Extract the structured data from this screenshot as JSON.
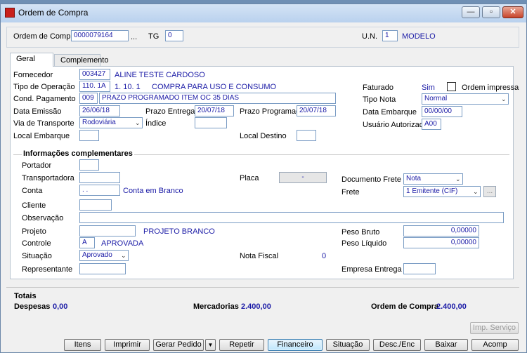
{
  "window": {
    "title": "Ordem de Compra",
    "min_label": "—",
    "max_label": "▫",
    "close_label": "✕"
  },
  "header": {
    "ordem_label": "Ordem de Compra",
    "ordem_value": "0000079164",
    "lookup": "...",
    "tg_label": "TG",
    "tg_value": "0",
    "un_label": "U.N.",
    "un_value": "1",
    "un_desc": "MODELO"
  },
  "tabs": [
    {
      "label": "Geral"
    },
    {
      "label": "Complemento"
    }
  ],
  "geral": {
    "fornecedor_label": "Fornecedor",
    "fornecedor_code": "003427",
    "fornecedor_name": "ALINE TESTE CARDOSO",
    "tipo_op_label": "Tipo de Operação",
    "tipo_op_code": "110. 1A",
    "tipo_op_num": "1. 10. 1",
    "tipo_op_desc": "COMPRA PARA USO E CONSUMO",
    "faturado_label": "Faturado",
    "faturado_value": "Sim",
    "ordem_impressa_label": "Ordem impressa",
    "cond_pag_label": "Cond. Pagamento",
    "cond_pag_code": "009",
    "cond_pag_desc": "PRAZO PROGRAMADO ITEM OC 35 DIAS",
    "tipo_nota_label": "Tipo Nota",
    "tipo_nota_value": "Normal",
    "data_emissao_label": "Data Emissão",
    "data_emissao_value": "26/06/18",
    "prazo_entrega_label": "Prazo Entrega",
    "prazo_entrega_value": "20/07/18",
    "prazo_prog_label": "Prazo Programado",
    "prazo_prog_value": "20/07/18",
    "data_embarque_label": "Data Embarque",
    "data_embarque_value": "00/00/00",
    "via_label": "Via de Transporte",
    "via_value": "Rodoviária",
    "indice_label": "Índice",
    "indice_value": "",
    "usuario_label": "Usuário Autorizado",
    "usuario_value": "A00",
    "local_emb_label": "Local Embarque",
    "local_dest_label": "Local Destino"
  },
  "info": {
    "title": "Informações complementares",
    "portador_label": "Portador",
    "transportadora_label": "Transportadora",
    "placa_label": "Placa",
    "placa_value": "-",
    "doc_frete_label": "Documento Frete",
    "doc_frete_value": "Nota",
    "conta_label": "Conta",
    "conta_value": ". .",
    "conta_desc": "Conta em Branco",
    "frete_label": "Frete",
    "frete_value": "1 Emitente (CIF)",
    "frete_btn": "...",
    "cliente_label": "Cliente",
    "obs_label": "Observação",
    "projeto_label": "Projeto",
    "projeto_desc": "PROJETO BRANCO",
    "peso_bruto_label": "Peso Bruto",
    "peso_bruto_value": "0,00000",
    "controle_label": "Controle",
    "controle_value": "A",
    "controle_desc": "APROVADA",
    "peso_liq_label": "Peso Líquido",
    "peso_liq_value": "0,00000",
    "situacao_label": "Situação",
    "situacao_value": "Aprovado",
    "nota_fiscal_label": "Nota Fiscal",
    "nota_fiscal_value": "0",
    "representante_label": "Representante",
    "empresa_label": "Empresa Entrega"
  },
  "totais": {
    "title": "Totais",
    "despesas_label": "Despesas",
    "despesas_value": "0,00",
    "mercadorias_label": "Mercadorias",
    "mercadorias_value": "2.400,00",
    "ordem_label": "Ordem de Compra",
    "ordem_value": "2.400,00"
  },
  "buttons": {
    "imp_servico": "Imp. Serviço",
    "itens": "Itens",
    "imprimir": "Imprimir",
    "gerar_pedido": "Gerar Pedido",
    "dropdown": "▼",
    "repetir": "Repetir",
    "financeiro": "Financeiro",
    "situacao": "Situação",
    "desc_enc": "Desc./Enc",
    "baixar": "Baixar",
    "acomp": "Acomp"
  }
}
